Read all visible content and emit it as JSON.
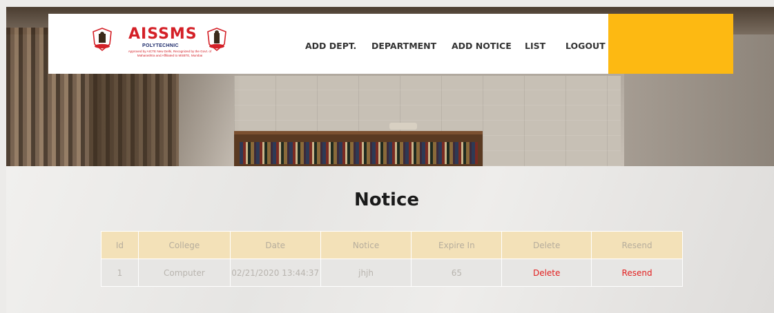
{
  "header": {
    "brand": "AISSMS",
    "brand_sub": "POLYTECHNIC",
    "brand_tagline": "Approved by AICTE New Delhi, Recognized by the Govt. of Maharashtra and Affiliated to MSBTE, Mumbai",
    "nav": {
      "add_dept": "ADD DEPT.",
      "department": "DEPARTMENT",
      "add_notice": "ADD NOTICE",
      "list": "LIST",
      "logout": "LOGOUT"
    }
  },
  "main": {
    "title": "Notice",
    "table": {
      "headers": [
        "Id",
        "College",
        "Date",
        "Notice",
        "Expire In",
        "Delete",
        "Resend"
      ],
      "rows": [
        {
          "id": "1",
          "college": "Computer",
          "date": "02/21/2020 13:44:37",
          "notice": "jhjh",
          "expire_in": "65",
          "delete": "Delete",
          "resend": "Resend"
        }
      ]
    }
  },
  "colors": {
    "accent": "#fdb912",
    "brand_red": "#d42027",
    "table_header_bg": "#f3e1b8",
    "link": "#e21d1d"
  },
  "icons": {
    "logo_left": "emblem-icon",
    "logo_right": "emblem-icon"
  }
}
